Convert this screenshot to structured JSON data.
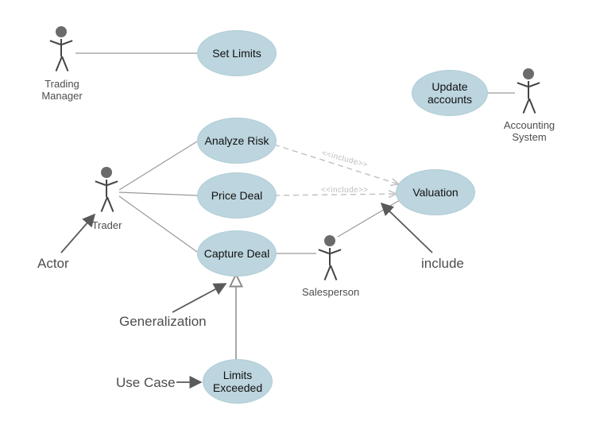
{
  "colors": {
    "usecase_fill": "#bcd5de",
    "actor_stroke": "#444444",
    "annotation_color": "#4d4d4d",
    "include_label_color": "#bdbdbd"
  },
  "actors": {
    "trading_manager": {
      "label": "Trading\nManager"
    },
    "trader": {
      "label": "Trader"
    },
    "salesperson": {
      "label": "Salesperson"
    },
    "accounting_system": {
      "label": "Accounting\nSystem"
    }
  },
  "usecases": {
    "set_limits": {
      "label": "Set Limits"
    },
    "analyze_risk": {
      "label": "Analyze Risk"
    },
    "price_deal": {
      "label": "Price Deal"
    },
    "capture_deal": {
      "label": "Capture Deal"
    },
    "limits_exceeded": {
      "label": "Limits\nExceeded"
    },
    "valuation": {
      "label": "Valuation"
    },
    "update_accounts": {
      "label": "Update\naccounts"
    }
  },
  "stereotypes": {
    "include": "<<include>>"
  },
  "annotations": {
    "actor": "Actor",
    "use_case": "Use Case",
    "generalization": "Generalization",
    "include": "include"
  },
  "chart_data": {
    "type": "uml-use-case",
    "actors": [
      "Trading Manager",
      "Trader",
      "Salesperson",
      "Accounting System"
    ],
    "usecases": [
      "Set Limits",
      "Analyze Risk",
      "Price Deal",
      "Capture Deal",
      "Limits Exceeded",
      "Valuation",
      "Update accounts"
    ],
    "associations": [
      [
        "Trading Manager",
        "Set Limits"
      ],
      [
        "Trader",
        "Analyze Risk"
      ],
      [
        "Trader",
        "Price Deal"
      ],
      [
        "Trader",
        "Capture Deal"
      ],
      [
        "Salesperson",
        "Capture Deal"
      ],
      [
        "Salesperson",
        "Valuation"
      ],
      [
        "Accounting System",
        "Update accounts"
      ]
    ],
    "includes": [
      [
        "Analyze Risk",
        "Valuation"
      ],
      [
        "Price Deal",
        "Valuation"
      ]
    ],
    "generalizations": [
      [
        "Limits Exceeded",
        "Capture Deal"
      ]
    ],
    "annotation_pointers": [
      {
        "label": "Actor",
        "points_to": "Trader"
      },
      {
        "label": "Use Case",
        "points_to": "Limits Exceeded"
      },
      {
        "label": "Generalization",
        "points_to": "generalization edge Limits Exceeded→Capture Deal"
      },
      {
        "label": "include",
        "points_to": "include edge Price Deal→Valuation"
      }
    ]
  }
}
